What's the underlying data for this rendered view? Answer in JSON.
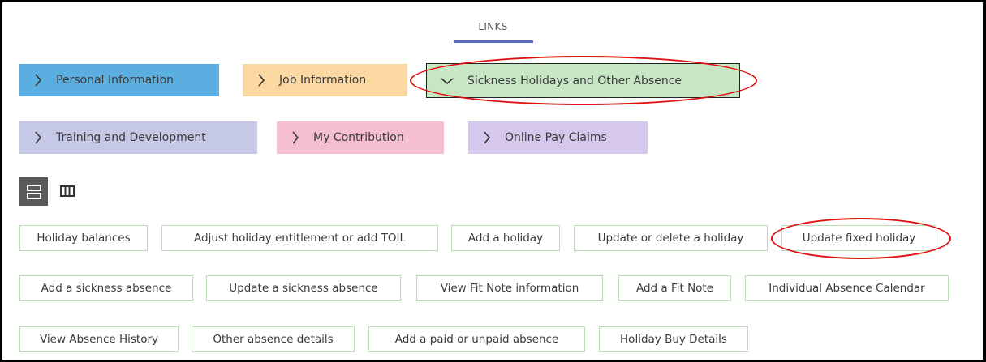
{
  "tabs": {
    "links_label": "LINKS"
  },
  "categories": {
    "personal": {
      "label": "Personal Information",
      "icon": "chevron-right-icon",
      "color": "#5aafe0"
    },
    "job": {
      "label": "Job Information",
      "icon": "chevron-right-icon",
      "color": "#fbd8a1"
    },
    "sickness": {
      "label": "Sickness Holidays and Other Absence",
      "icon": "chevron-down-icon",
      "color": "#c7e6c3",
      "expanded": true
    },
    "training": {
      "label": "Training and Development",
      "icon": "chevron-right-icon",
      "color": "#c5c9e6"
    },
    "contribution": {
      "label": "My Contribution",
      "icon": "chevron-right-icon",
      "color": "#f6bfd1"
    },
    "pay": {
      "label": "Online Pay Claims",
      "icon": "chevron-right-icon",
      "color": "#d6c7ec"
    }
  },
  "view_toggle": {
    "list_icon": "list-view-icon",
    "columns_icon": "column-view-icon",
    "selected": "list"
  },
  "links": {
    "row1": [
      "Holiday balances",
      "Adjust holiday entitlement or add TOIL",
      "Add a holiday",
      "Update or delete a holiday",
      "Update fixed holiday"
    ],
    "row2": [
      "Add a sickness absence",
      "Update a sickness absence",
      "View Fit Note information",
      "Add a Fit Note",
      "Individual Absence Calendar"
    ],
    "row3": [
      "View Absence History",
      "Other absence details",
      "Add a paid or unpaid absence",
      "Holiday Buy Details"
    ]
  },
  "annotations": {
    "highlight_color": "#e01010"
  }
}
